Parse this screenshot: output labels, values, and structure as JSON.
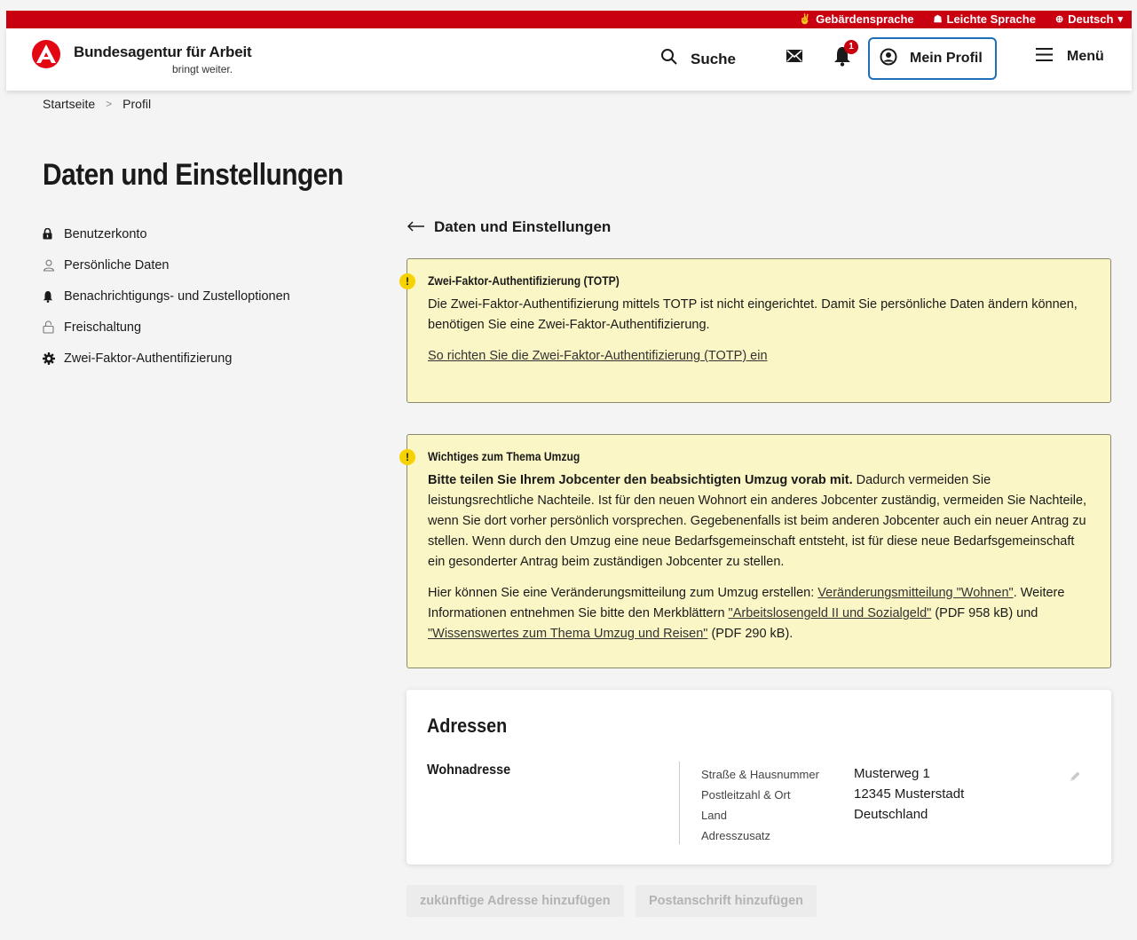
{
  "topbar": {
    "sign_language": "Gebärdensprache",
    "easy_language": "Leichte Sprache",
    "language": "Deutsch"
  },
  "header": {
    "brand_title": "Bundesagentur für Arbeit",
    "brand_sub": "bringt weiter.",
    "search_label": "Suche",
    "notification_count": "1",
    "profile_label": "Mein Profil",
    "menu_label": "Menü"
  },
  "breadcrumb": {
    "home": "Startseite",
    "separator": ">",
    "current": "Profil"
  },
  "page_title": "Daten und Einstellungen",
  "sidenav": {
    "items": [
      {
        "label": "Benutzerkonto",
        "icon": "lock-icon"
      },
      {
        "label": "Persönliche Daten",
        "icon": "person-icon"
      },
      {
        "label": "Benachrichtigungs- und Zustelloptionen",
        "icon": "bell-icon"
      },
      {
        "label": "Freischaltung",
        "icon": "unlock-icon"
      },
      {
        "label": "Zwei-Faktor-Authentifizierung",
        "icon": "gear-icon"
      }
    ]
  },
  "back_link": "Daten und Einstellungen",
  "notice_totp": {
    "title": "Zwei-Faktor-Authentifizierung (TOTP)",
    "text": "Die Zwei-Faktor-Authentifizierung mittels TOTP ist nicht eingerichtet. Damit Sie persönliche Daten ändern können, benötigen Sie eine Zwei-Faktor-Authentifizierung.",
    "link": "So richten Sie die Zwei-Faktor-Authentifizierung (TOTP) ein"
  },
  "notice_move": {
    "title": "Wichtiges zum Thema Umzug",
    "lead_bold": "Bitte teilen Sie Ihrem Jobcenter den beabsichtigten Umzug vorab mit.",
    "lead_rest": " Dadurch vermeiden Sie leistungsrechtliche Nachteile. Ist für den neuen Wohnort ein anderes Jobcenter zuständig, vermeiden Sie Nachteile, wenn Sie dort vorher persönlich vorsprechen. Gegebenenfalls ist beim anderen Jobcenter auch ein neuer Antrag zu stellen. Wenn durch den Umzug eine neue Bedarfsgemeinschaft entsteht, ist für diese neue Bedarfsgemeinschaft ein gesonderter Antrag beim zuständigen Jobcenter zu stellen.",
    "p2_a": "Hier können Sie eine Veränderungsmitteilung zum Umzug erstellen: ",
    "p2_link1": "Veränderungsmitteilung \"Wohnen\"",
    "p2_b": ". Weitere Informationen entnehmen Sie bitte den Merkblättern ",
    "p2_link2": "\"Arbeitslosengeld II und Sozialgeld\"",
    "p2_c": " (PDF 958 kB) und ",
    "p2_link3": "\"Wissenswertes zum Thema Umzug und Reisen\"",
    "p2_d": " (PDF 290 kB)."
  },
  "addresses": {
    "title": "Adressen",
    "section": "Wohnadresse",
    "labels": [
      "Straße & Hausnummer",
      "Postleitzahl & Ort",
      "Land",
      "Adresszusatz"
    ],
    "values": [
      "Musterweg 1",
      "12345 Musterstadt",
      "Deutschland",
      ""
    ]
  },
  "buttons": {
    "future_address": "zukünftige Adresse hinzufügen",
    "postal_address": "Postanschrift hinzufügen"
  },
  "colors": {
    "brand_red": "#c8000f",
    "notice_bg": "#fbf6c5",
    "profile_border": "#1d6fb8"
  }
}
